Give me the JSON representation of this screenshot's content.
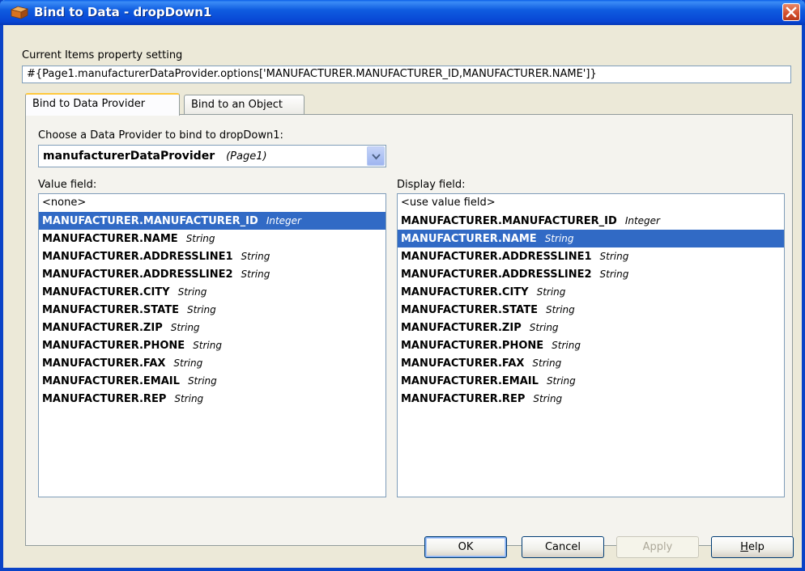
{
  "window": {
    "title": "Bind to Data - dropDown1",
    "accent": "#0A43C7",
    "selection_color": "#316AC5"
  },
  "property": {
    "label": "Current Items property setting",
    "value": "#{Page1.manufacturerDataProvider.options['MANUFACTURER.MANUFACTURER_ID,MANUFACTURER.NAME']}"
  },
  "tabs": [
    {
      "label": "Bind to Data Provider",
      "active": true
    },
    {
      "label": "Bind to an Object",
      "active": false
    }
  ],
  "provider": {
    "label": "Choose a Data Provider to bind to dropDown1:",
    "selected_name": "manufacturerDataProvider",
    "selected_scope": "(Page1)"
  },
  "value_list": {
    "label": "Value field:",
    "none_option": "<none>",
    "items": [
      {
        "field": "MANUFACTURER.MANUFACTURER_ID",
        "type": "Integer",
        "selected": true
      },
      {
        "field": "MANUFACTURER.NAME",
        "type": "String"
      },
      {
        "field": "MANUFACTURER.ADDRESSLINE1",
        "type": "String"
      },
      {
        "field": "MANUFACTURER.ADDRESSLINE2",
        "type": "String"
      },
      {
        "field": "MANUFACTURER.CITY",
        "type": "String"
      },
      {
        "field": "MANUFACTURER.STATE",
        "type": "String"
      },
      {
        "field": "MANUFACTURER.ZIP",
        "type": "String"
      },
      {
        "field": "MANUFACTURER.PHONE",
        "type": "String"
      },
      {
        "field": "MANUFACTURER.FAX",
        "type": "String"
      },
      {
        "field": "MANUFACTURER.EMAIL",
        "type": "String"
      },
      {
        "field": "MANUFACTURER.REP",
        "type": "String"
      }
    ]
  },
  "display_list": {
    "label": "Display field:",
    "none_option": "<use value field>",
    "items": [
      {
        "field": "MANUFACTURER.MANUFACTURER_ID",
        "type": "Integer"
      },
      {
        "field": "MANUFACTURER.NAME",
        "type": "String",
        "selected": true
      },
      {
        "field": "MANUFACTURER.ADDRESSLINE1",
        "type": "String"
      },
      {
        "field": "MANUFACTURER.ADDRESSLINE2",
        "type": "String"
      },
      {
        "field": "MANUFACTURER.CITY",
        "type": "String"
      },
      {
        "field": "MANUFACTURER.STATE",
        "type": "String"
      },
      {
        "field": "MANUFACTURER.ZIP",
        "type": "String"
      },
      {
        "field": "MANUFACTURER.PHONE",
        "type": "String"
      },
      {
        "field": "MANUFACTURER.FAX",
        "type": "String"
      },
      {
        "field": "MANUFACTURER.EMAIL",
        "type": "String"
      },
      {
        "field": "MANUFACTURER.REP",
        "type": "String"
      }
    ]
  },
  "buttons": {
    "ok": "OK",
    "cancel": "Cancel",
    "apply": "Apply",
    "help_prefix": "H",
    "help_rest": "elp"
  }
}
